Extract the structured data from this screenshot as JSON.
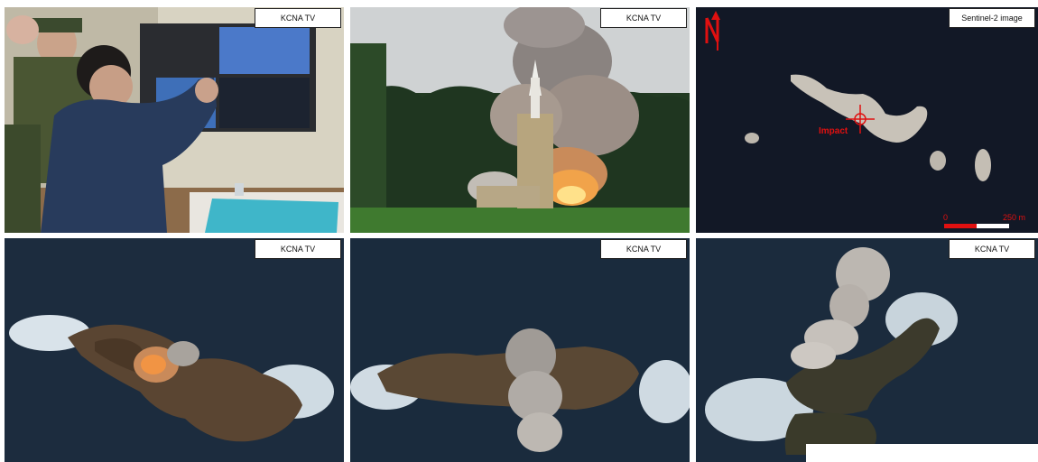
{
  "panels": [
    {
      "id": "p1",
      "label": "KCNA TV"
    },
    {
      "id": "p2",
      "label": "KCNA TV"
    },
    {
      "id": "p3",
      "label": "Sentinel-2 image"
    },
    {
      "id": "p4",
      "label": "KCNA TV"
    },
    {
      "id": "p5",
      "label": "KCNA TV"
    },
    {
      "id": "p6",
      "label": "KCNA TV"
    }
  ],
  "satellite": {
    "impact_label": "Impact",
    "scale_start": "0",
    "scale_end": "250 m",
    "north_label": "N"
  },
  "colors": {
    "sea": "#1c2c3e",
    "satellite_bg": "#121826",
    "marker": "#e01010"
  }
}
